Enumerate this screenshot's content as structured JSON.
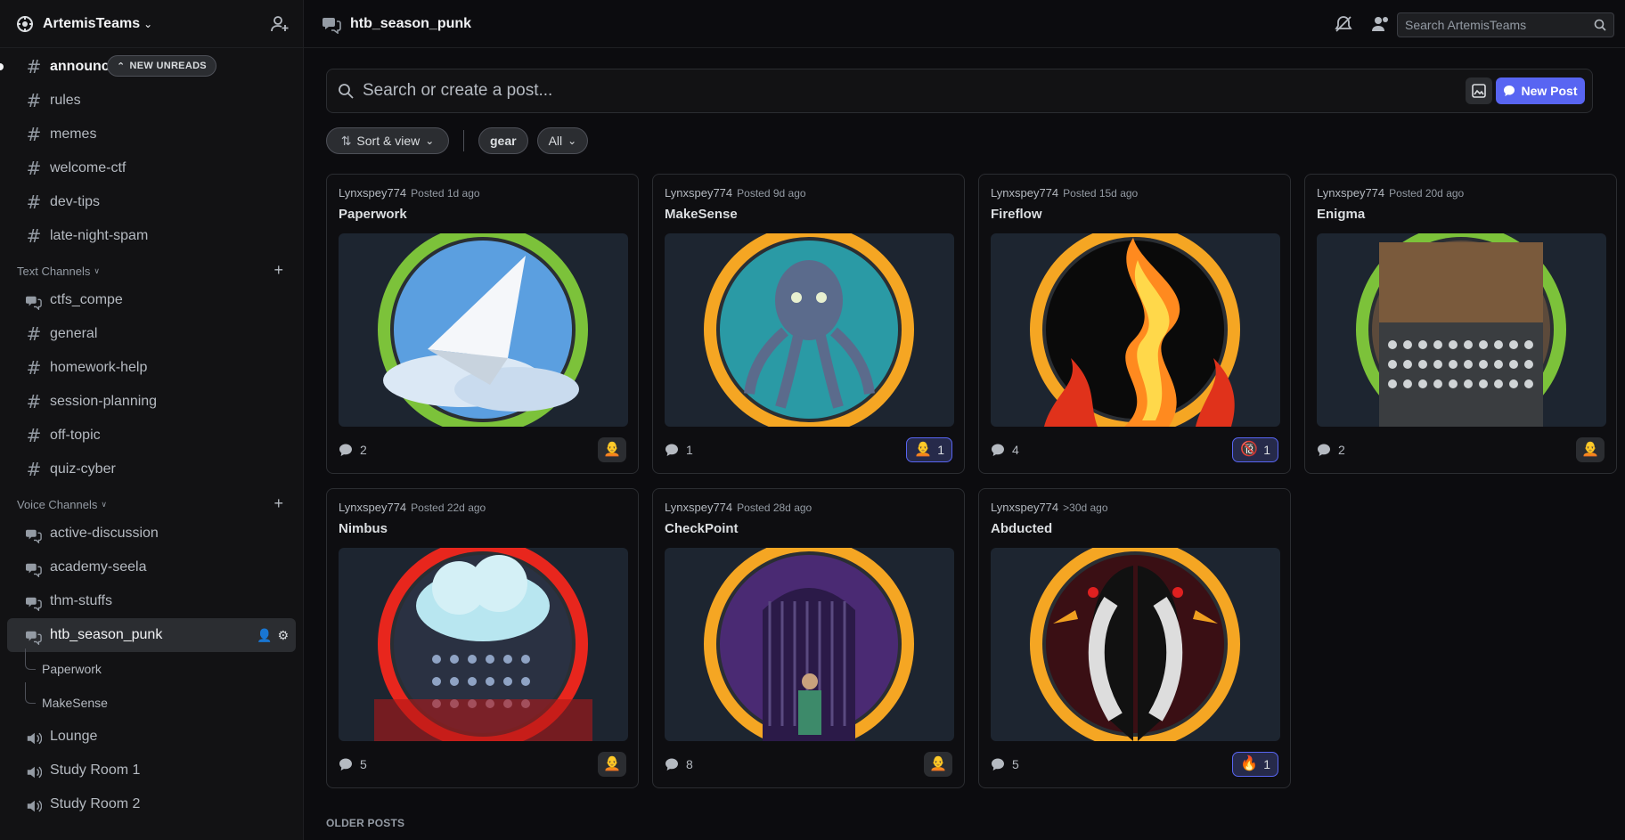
{
  "server": {
    "name": "ArtemisTeams"
  },
  "sidebar": {
    "new_unreads": "NEW UNREADS",
    "top_channels": [
      {
        "name": "announcements",
        "display": "announce",
        "type": "text",
        "unread": true
      },
      {
        "name": "rules",
        "display": "rules",
        "type": "text"
      },
      {
        "name": "memes",
        "display": "memes",
        "type": "text"
      },
      {
        "name": "welcome-ctf",
        "display": "welcome-ctf",
        "type": "text"
      },
      {
        "name": "dev-tips",
        "display": "dev-tips",
        "type": "text"
      },
      {
        "name": "late-night-spam",
        "display": "late-night-spam",
        "type": "text"
      }
    ],
    "text_category": "Text Channels",
    "text_channels": [
      {
        "name": "ctfs_compe",
        "type": "forum"
      },
      {
        "name": "general",
        "type": "text"
      },
      {
        "name": "homework-help",
        "type": "text"
      },
      {
        "name": "session-planning",
        "type": "text"
      },
      {
        "name": "off-topic",
        "type": "text"
      },
      {
        "name": "quiz-cyber",
        "type": "text"
      }
    ],
    "voice_category": "Voice Channels",
    "voice_forums": [
      {
        "name": "active-discussion"
      },
      {
        "name": "academy-seela"
      },
      {
        "name": "thm-stuffs"
      },
      {
        "name": "htb_season_punk",
        "active": true
      }
    ],
    "threads": [
      {
        "name": "Paperwork"
      },
      {
        "name": "MakeSense"
      }
    ],
    "voice_channels": [
      {
        "name": "Lounge"
      },
      {
        "name": "Study Room 1"
      },
      {
        "name": "Study Room 2"
      }
    ]
  },
  "topbar": {
    "channel": "htb_season_punk",
    "search_placeholder": "Search ArtemisTeams"
  },
  "main": {
    "post_search_placeholder": "Search or create a post...",
    "new_post_label": "New Post",
    "sort_label": "Sort & view",
    "tag_chip": "gear",
    "all_chip": "All",
    "older_posts": "OLDER POSTS"
  },
  "posts": [
    {
      "author": "Lynxspey774",
      "ago": "Posted 1d ago",
      "title": "Paperwork",
      "messages": "2",
      "reaction": {
        "emoji": "🧑‍🦲",
        "count": ""
      },
      "ring": "#7cc23a",
      "art": "paper"
    },
    {
      "author": "Lynxspey774",
      "ago": "Posted 9d ago",
      "title": "MakeSense",
      "messages": "1",
      "reaction": {
        "emoji": "🧑‍🦲",
        "count": "1"
      },
      "ring": "#f5a623",
      "art": "octopus"
    },
    {
      "author": "Lynxspey774",
      "ago": "Posted 15d ago",
      "title": "Fireflow",
      "messages": "4",
      "reaction": {
        "emoji": "🔞",
        "count": "1"
      },
      "ring": "#f5a623",
      "art": "fire"
    },
    {
      "author": "Lynxspey774",
      "ago": "Posted 20d ago",
      "title": "Enigma",
      "messages": "2",
      "reaction": {
        "emoji": "🧑‍🦲",
        "count": ""
      },
      "ring": "#7cc23a",
      "art": "enigma"
    },
    {
      "author": "Lynxspey774",
      "ago": "Posted 22d ago",
      "title": "Nimbus",
      "messages": "5",
      "reaction": {
        "emoji": "🧑‍🦲",
        "count": ""
      },
      "ring": "#e8261d",
      "art": "cloud"
    },
    {
      "author": "Lynxspey774",
      "ago": "Posted 28d ago",
      "title": "CheckPoint",
      "messages": "8",
      "reaction": {
        "emoji": "🧑‍🦲",
        "count": ""
      },
      "ring": "#f5a623",
      "art": "gate"
    },
    {
      "author": "Lynxspey774",
      "ago": ">30d ago",
      "title": "Abducted",
      "messages": "5",
      "reaction": {
        "emoji": "🔥",
        "count": "1"
      },
      "ring": "#f5a623",
      "art": "birds"
    }
  ]
}
